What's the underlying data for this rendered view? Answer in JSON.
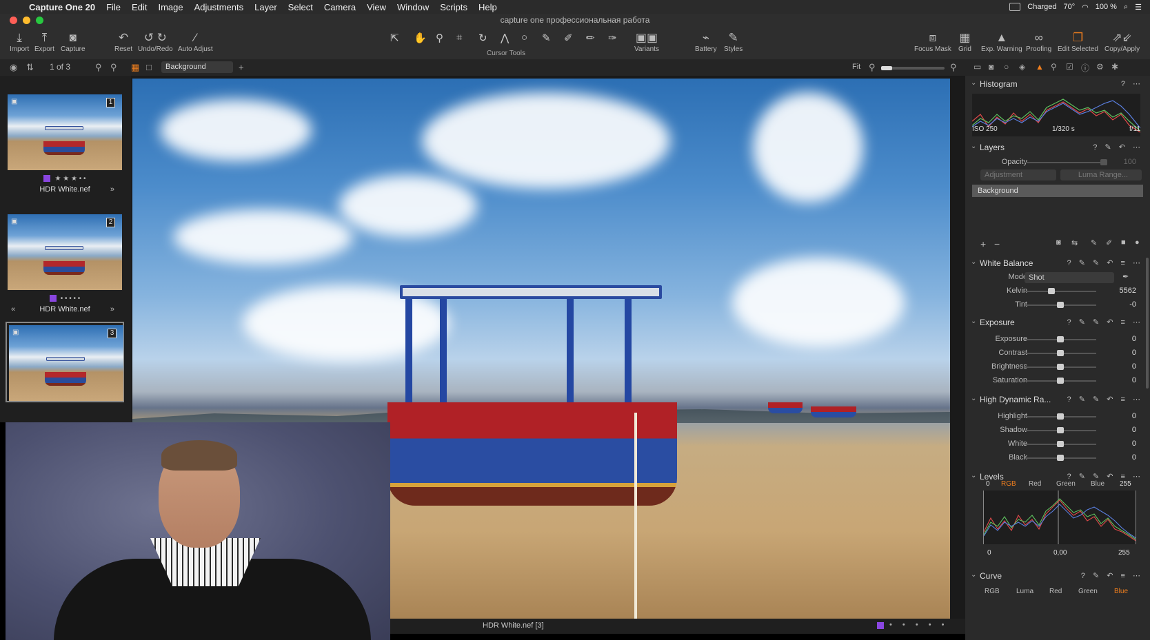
{
  "menubar": {
    "app": "Capture One 20",
    "items": [
      "File",
      "Edit",
      "Image",
      "Adjustments",
      "Layer",
      "Select",
      "Camera",
      "View",
      "Window",
      "Scripts",
      "Help"
    ],
    "status": {
      "charged": "Charged",
      "temp": "70°",
      "battery": "100 %"
    }
  },
  "window": {
    "title": "capture one профессиональная работа"
  },
  "toolbar": {
    "import": "Import",
    "export": "Export",
    "capture": "Capture",
    "reset": "Reset",
    "undo_redo": "Undo/Redo",
    "auto_adjust": "Auto Adjust",
    "cursor_tools": "Cursor Tools",
    "variants": "Variants",
    "battery": "Battery",
    "styles": "Styles",
    "focus_mask": "Focus Mask",
    "grid": "Grid",
    "exp_warning": "Exp. Warning",
    "proofing": "Proofing",
    "edit_selected": "Edit Selected",
    "copy_apply": "Copy/Apply"
  },
  "subbar": {
    "counter": "1 of 3",
    "layer": "Background",
    "fit": "Fit"
  },
  "browser": {
    "thumbs": [
      {
        "num": "1",
        "name": "HDR White.nef",
        "rating": "★ ★ ★ • •"
      },
      {
        "num": "2",
        "name": "HDR White.nef",
        "rating": "• • • • •"
      },
      {
        "num": "3",
        "name": "HDR White.nef",
        "rating": ""
      }
    ]
  },
  "viewer": {
    "caption": "HDR White.nef [3]",
    "dots": "• • • • •"
  },
  "panel": {
    "histogram": {
      "title": "Histogram",
      "iso": "ISO 250",
      "shutter": "1/320 s",
      "aperture": "f/11"
    },
    "layers": {
      "title": "Layers",
      "opacity_label": "Opacity",
      "opacity_value": "100",
      "adjustment": "Adjustment",
      "luma_range": "Luma Range...",
      "layer_name": "Background"
    },
    "white_balance": {
      "title": "White Balance",
      "mode_label": "Mode",
      "mode_value": "Shot",
      "kelvin_label": "Kelvin",
      "kelvin_value": "5562",
      "tint_label": "Tint",
      "tint_value": "-0"
    },
    "exposure": {
      "title": "Exposure",
      "rows": [
        {
          "label": "Exposure",
          "value": "0"
        },
        {
          "label": "Contrast",
          "value": "0"
        },
        {
          "label": "Brightness",
          "value": "0"
        },
        {
          "label": "Saturation",
          "value": "0"
        }
      ]
    },
    "hdr": {
      "title": "High Dynamic Ra...",
      "rows": [
        {
          "label": "Highlight",
          "value": "0"
        },
        {
          "label": "Shadow",
          "value": "0"
        },
        {
          "label": "White",
          "value": "0"
        },
        {
          "label": "Black",
          "value": "0"
        }
      ]
    },
    "levels": {
      "title": "Levels",
      "low": "0",
      "high": "255",
      "tabs": [
        "RGB",
        "Red",
        "Green",
        "Blue"
      ],
      "out_low": "0",
      "mid": "0,00",
      "out_high": "255"
    },
    "curve": {
      "title": "Curve",
      "tabs": [
        "RGB",
        "Luma",
        "Red",
        "Green",
        "Blue"
      ]
    }
  },
  "colors": {
    "accent": "#f07f1e",
    "color_tag": "#8a46e0"
  }
}
